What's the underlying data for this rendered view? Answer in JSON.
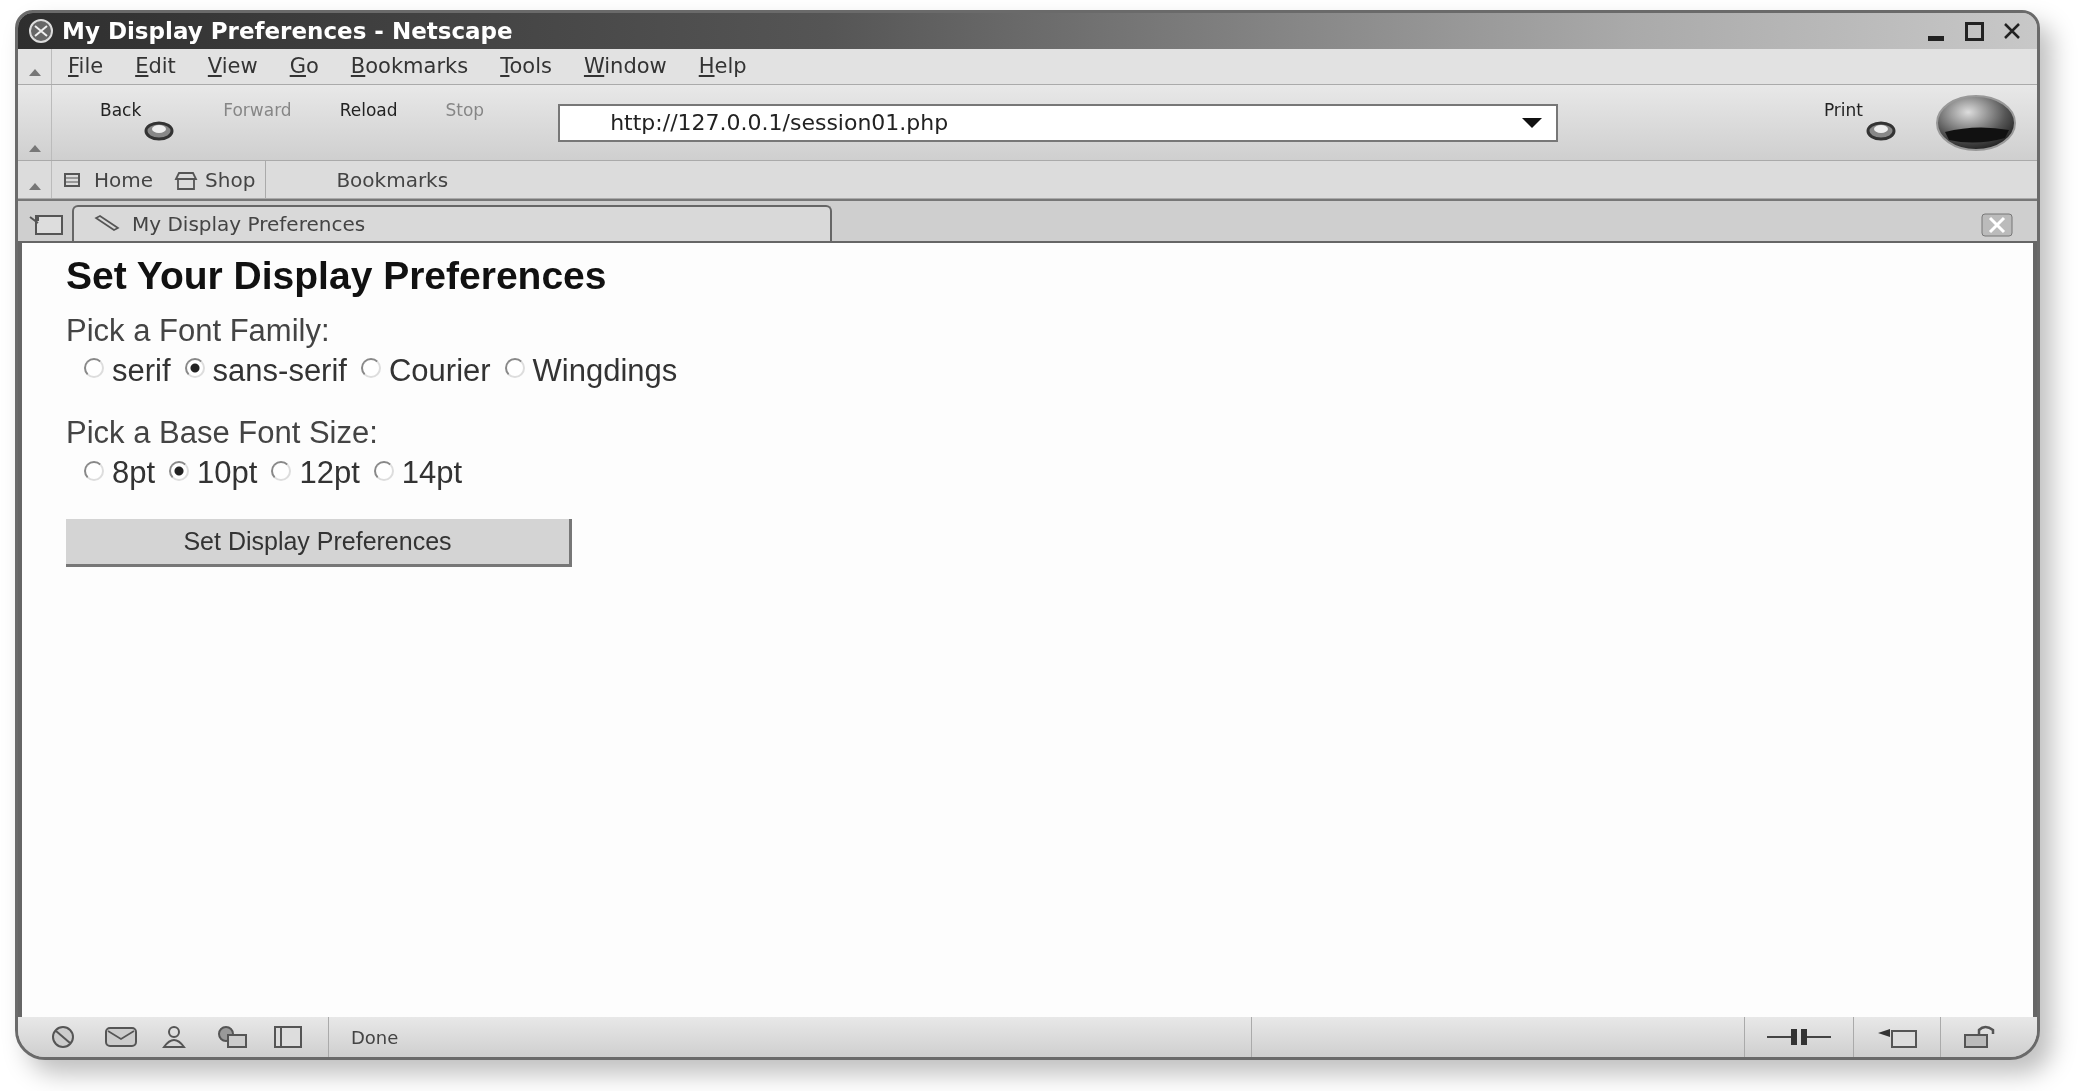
{
  "window": {
    "title": "My Display Preferences - Netscape"
  },
  "menu": [
    "File",
    "Edit",
    "View",
    "Go",
    "Bookmarks",
    "Tools",
    "Window",
    "Help"
  ],
  "nav_toolbar": {
    "buttons": [
      {
        "label": "Back",
        "disabled": false,
        "dropdown": true
      },
      {
        "label": "Forward",
        "disabled": true,
        "dropdown": false
      },
      {
        "label": "Reload",
        "disabled": false,
        "dropdown": false
      },
      {
        "label": "Stop",
        "disabled": true,
        "dropdown": false
      }
    ],
    "url": "http://127.0.0.1/session01.php",
    "print": {
      "label": "Print",
      "disabled": false,
      "dropdown": true
    }
  },
  "personal_toolbar": {
    "items": [
      {
        "label": "Home",
        "kind": "home"
      },
      {
        "label": "Shop",
        "kind": "shop"
      }
    ],
    "bookmarks": "Bookmarks"
  },
  "tabs": [
    {
      "label": "My Display Preferences",
      "selected": true
    }
  ],
  "page": {
    "heading": "Set Your Display Preferences",
    "groups": [
      {
        "label": "Pick a Font Family:",
        "options": [
          {
            "label": "serif",
            "selected": false
          },
          {
            "label": "sans-serif",
            "selected": true
          },
          {
            "label": "Courier",
            "selected": false
          },
          {
            "label": "Wingdings",
            "selected": false
          }
        ]
      },
      {
        "label": "Pick a Base Font Size:",
        "options": [
          {
            "label": "8pt",
            "selected": false
          },
          {
            "label": "10pt",
            "selected": true
          },
          {
            "label": "12pt",
            "selected": false
          },
          {
            "label": "14pt",
            "selected": false
          }
        ]
      }
    ],
    "submit": "Set Display Preferences"
  },
  "status_bar": {
    "text": "Done"
  }
}
